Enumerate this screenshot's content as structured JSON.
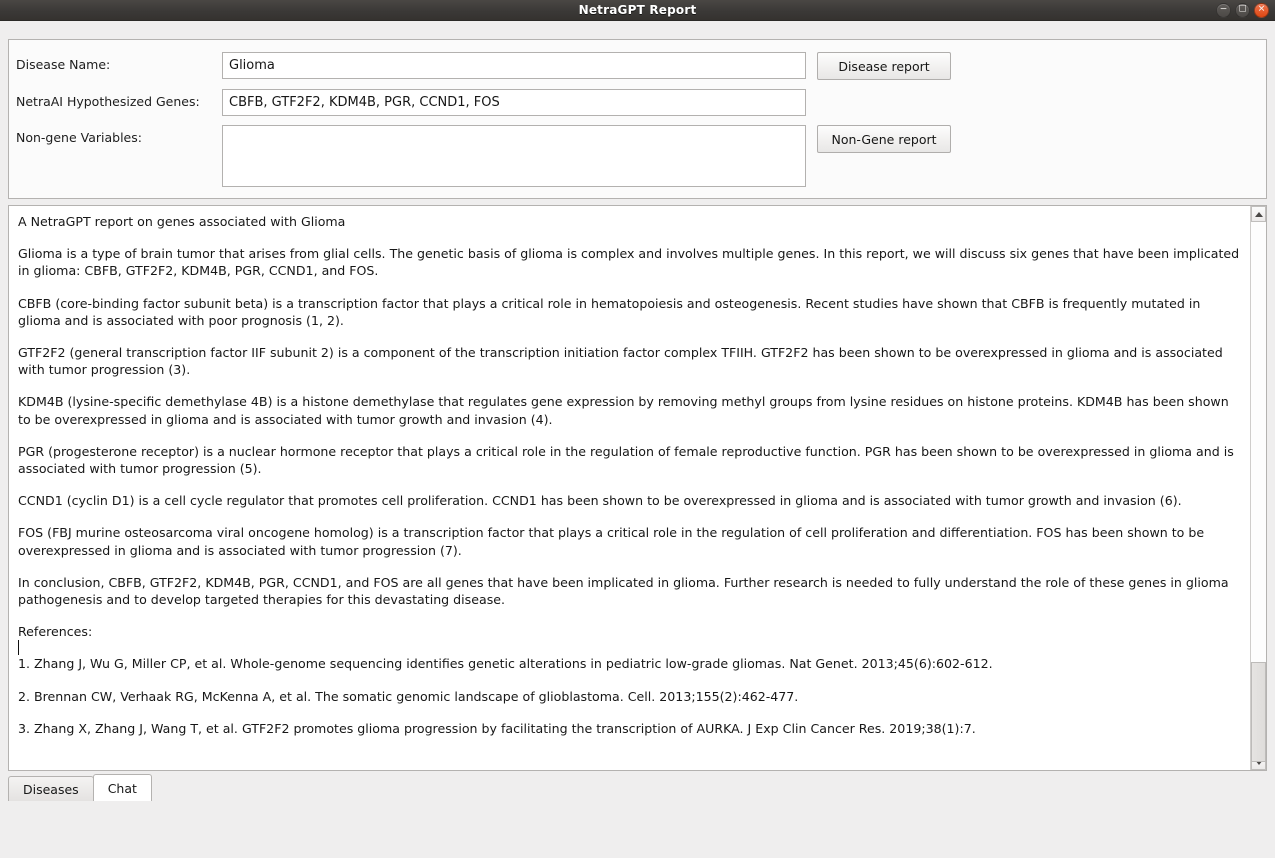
{
  "window": {
    "title": "NetraGPT Report",
    "controls": [
      {
        "name": "minimize",
        "glyph": "−"
      },
      {
        "name": "maximize",
        "glyph": "☐"
      },
      {
        "name": "close",
        "glyph": "✕"
      }
    ]
  },
  "form": {
    "disease_name_label": "Disease Name:",
    "disease_name_value": "Glioma",
    "disease_name_placeholder": "",
    "genes_label": "NetraAI Hypothesized Genes:",
    "genes_value": "CBFB, GTF2F2, KDM4B, PGR, CCND1, FOS",
    "genes_placeholder": "",
    "nongene_label": "Non-gene Variables:",
    "nongene_value": "",
    "nongene_placeholder": "",
    "disease_report_button": "Disease report",
    "nongene_report_button": "Non-Gene report"
  },
  "report": {
    "paragraphs": [
      "A NetraGPT report on genes associated with Glioma",
      "Glioma is a type of brain tumor that arises from glial cells. The genetic basis of glioma is complex and involves multiple genes. In this report, we will discuss six genes that have been implicated in glioma: CBFB, GTF2F2, KDM4B, PGR, CCND1, and FOS.",
      "CBFB (core-binding factor subunit beta) is a transcription factor that plays a critical role in hematopoiesis and osteogenesis. Recent studies have shown that CBFB is frequently mutated in glioma and is associated with poor prognosis (1, 2).",
      "GTF2F2 (general transcription factor IIF subunit 2) is a component of the transcription initiation factor complex TFIIH. GTF2F2 has been shown to be overexpressed in glioma and is associated with tumor progression (3).",
      "KDM4B (lysine-specific demethylase 4B) is a histone demethylase that regulates gene expression by removing methyl groups from lysine residues on histone proteins. KDM4B has been shown to be overexpressed in glioma and is associated with tumor growth and invasion (4).",
      "PGR (progesterone receptor) is a nuclear hormone receptor that plays a critical role in the regulation of female reproductive function. PGR has been shown to be overexpressed in glioma and is associated with tumor progression (5).",
      "CCND1 (cyclin D1) is a cell cycle regulator that promotes cell proliferation. CCND1 has been shown to be overexpressed in glioma and is associated with tumor growth and invasion (6).",
      "FOS (FBJ murine osteosarcoma viral oncogene homolog) is a transcription factor that plays a critical role in the regulation of cell proliferation and differentiation. FOS has been shown to be overexpressed in glioma and is associated with tumor progression (7).",
      "In conclusion, CBFB, GTF2F2, KDM4B, PGR, CCND1, and FOS are all genes that have been implicated in glioma. Further research is needed to fully understand the role of these genes in glioma pathogenesis and to develop targeted therapies for this devastating disease.",
      "References:",
      "1. Zhang J, Wu G, Miller CP, et al. Whole-genome sequencing identifies genetic alterations in pediatric low-grade gliomas. Nat Genet. 2013;45(6):602-612.",
      "2. Brennan CW, Verhaak RG, McKenna A, et al. The somatic genomic landscape of glioblastoma. Cell. 2013;155(2):462-477.",
      "3. Zhang X, Zhang J, Wang T, et al. GTF2F2 promotes glioma progression by facilitating the transcription of AURKA. J Exp Clin Cancer Res. 2019;38(1):7."
    ]
  },
  "scrollbar": {
    "up_arrow": "▲",
    "down_arrow": "▼"
  },
  "tabs": [
    {
      "label": "Diseases",
      "active": false
    },
    {
      "label": "Chat",
      "active": true
    }
  ],
  "colors": {
    "titlebar": "#3b3937",
    "close_button": "#dd4814",
    "panel_border": "#b4b2b0",
    "window_bg": "#efeeee",
    "field_bg": "#ffffff"
  }
}
